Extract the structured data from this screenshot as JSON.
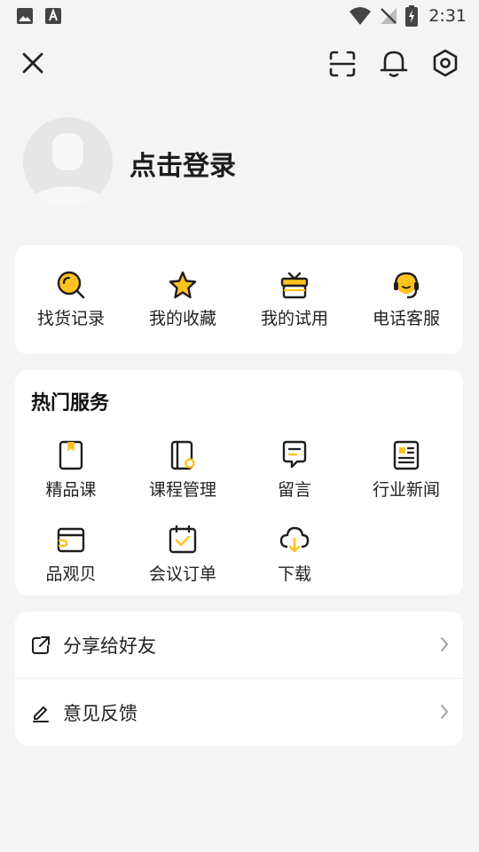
{
  "status_bar": {
    "time": "2:31",
    "left_icons": [
      "image-icon",
      "font-icon"
    ],
    "right_icons": [
      "wifi-icon",
      "no-signal-icon",
      "battery-charging-icon"
    ]
  },
  "header": {
    "icons": [
      "close-icon",
      "scan-icon",
      "bell-icon",
      "settings-icon"
    ]
  },
  "profile": {
    "login_label": "点击登录"
  },
  "quick_actions": [
    {
      "label": "找货记录",
      "icon": "search-icon"
    },
    {
      "label": "我的收藏",
      "icon": "star-icon"
    },
    {
      "label": "我的试用",
      "icon": "gift-icon"
    },
    {
      "label": "电话客服",
      "icon": "headset-icon"
    }
  ],
  "services": {
    "title": "热门服务",
    "items": [
      {
        "label": "精品课",
        "icon": "bookmark-book-icon"
      },
      {
        "label": "课程管理",
        "icon": "notebook-settings-icon"
      },
      {
        "label": "留言",
        "icon": "message-icon"
      },
      {
        "label": "行业新闻",
        "icon": "newspaper-icon"
      },
      {
        "label": "品观贝",
        "icon": "wallet-icon"
      },
      {
        "label": "会议订单",
        "icon": "calendar-check-icon"
      },
      {
        "label": "下载",
        "icon": "cloud-download-icon"
      }
    ]
  },
  "menu": [
    {
      "label": "分享给好友",
      "icon": "share-icon"
    },
    {
      "label": "意见反馈",
      "icon": "edit-icon"
    }
  ],
  "colors": {
    "accent": "#FFC21E",
    "background": "#F4F4F4",
    "card": "#FFFFFF",
    "icon_stroke": "#1E1E1E"
  }
}
